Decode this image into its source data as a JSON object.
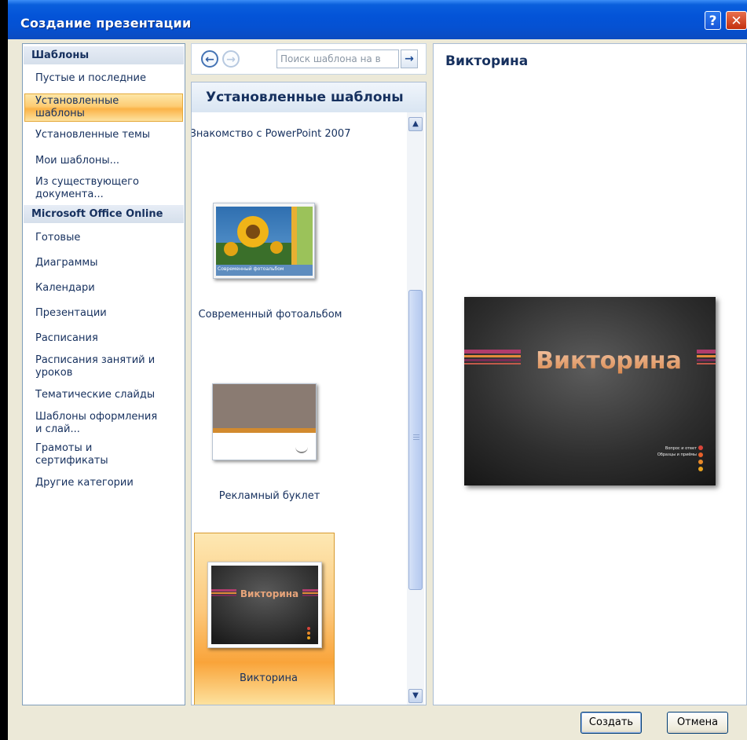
{
  "window": {
    "title": "Создание презентации",
    "help_label": "?",
    "close_label": "✕"
  },
  "categories": {
    "section1": "Шаблоны",
    "items1": [
      "Пустые и последние",
      "Установленные шаблоны",
      "Установленные темы",
      "Мои шаблоны...",
      "Из существующего документа..."
    ],
    "selected_index": 1,
    "section2": "Microsoft Office Online",
    "items2": [
      "Готовые",
      "Диаграммы",
      "Календари",
      "Презентации",
      "Расписания",
      "Расписания занятий и уроков",
      "Тематические слайды",
      "Шаблоны оформления и слай...",
      "Грамоты и сертификаты",
      "Другие категории"
    ]
  },
  "nav": {
    "back_icon": "arrow-left-icon",
    "forward_icon": "arrow-right-icon",
    "search_placeholder": "Поиск шаблона на в",
    "search_go_icon": "arrow-right-icon"
  },
  "templates": {
    "header": "Установленные шаблоны",
    "items": [
      "Знакомство с PowerPoint 2007",
      "Современный фотоальбом",
      "Рекламный буклет",
      "Викторина"
    ],
    "selected_index": 3,
    "thumb_photo_caption": "Современный фотоальбом"
  },
  "preview": {
    "title": "Викторина",
    "slide_title": "Викторина",
    "slide_bullets": [
      "Вопрос и ответ",
      "Образцы и приёмы"
    ]
  },
  "buttons": {
    "create": "Создать",
    "cancel": "Отмена"
  },
  "colors": {
    "title_bar": "#0454d8",
    "selection_orange": "#fbb347",
    "nav_text": "#16305e",
    "slide_background": "#3a3a3a",
    "slide_title": "#e7a47a"
  }
}
